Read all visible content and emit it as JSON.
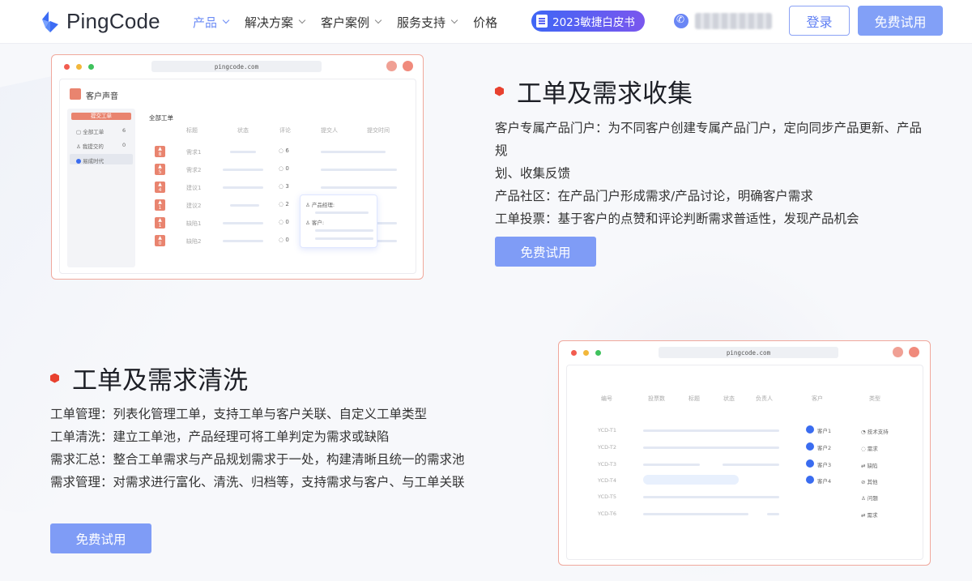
{
  "header": {
    "logo_text": "PingCode",
    "nav": [
      {
        "label": "产品",
        "has_dropdown": true,
        "active": true
      },
      {
        "label": "解决方案",
        "has_dropdown": true,
        "active": false
      },
      {
        "label": "客户案例",
        "has_dropdown": true,
        "active": false
      },
      {
        "label": "服务支持",
        "has_dropdown": true,
        "active": false
      },
      {
        "label": "价格",
        "has_dropdown": false,
        "active": false
      }
    ],
    "badge": "2023敏捷白皮书",
    "login": "登录",
    "trial": "免费试用",
    "accent": "#6b8bf5"
  },
  "section1": {
    "title": "工单及需求收集",
    "lines": [
      "客户专属产品门户：为不同客户创建专属产品门户，定向同步产品更新、产品规",
      "划、收集反馈",
      "产品社区：在产品门户形成需求/产品讨论，明确客户需求",
      "工单投票：基于客户的点赞和评论判断需求普适性，发现产品机会"
    ],
    "cta": "免费试用"
  },
  "section2": {
    "title": "工单及需求清洗",
    "lines": [
      "工单管理：列表化管理工单，支持工单与客户关联、自定义工单类型",
      "工单清洗：建立工单池，产品经理可将工单判定为需求或缺陷",
      "需求汇总：整合工单需求与产品规划需求于一处，构建清晰且统一的需求池",
      "需求管理：对需求进行富化、清洗、归档等，支持需求与客户、与工单关联"
    ],
    "cta": "免费试用"
  },
  "mock1": {
    "url": "pingcode.com",
    "app_title": "客户声音",
    "submit_btn": "提交工单",
    "side_items": [
      {
        "label": "全部工单",
        "count": "6"
      },
      {
        "label": "我提交的",
        "count": "0"
      },
      {
        "label": "易成时代",
        "count": ""
      }
    ],
    "section_label": "全部工单",
    "columns": [
      "标题",
      "状态",
      "评论",
      "提交人",
      "提交时间"
    ],
    "rows": [
      {
        "votes": "8",
        "title": "需求1",
        "comments": "6"
      },
      {
        "votes": "5",
        "title": "需求2",
        "comments": "0"
      },
      {
        "votes": "4",
        "title": "建议1",
        "comments": "3"
      },
      {
        "votes": "1",
        "title": "建议2",
        "comments": "2"
      },
      {
        "votes": "1",
        "title": "缺陷1",
        "comments": "0"
      },
      {
        "votes": "0",
        "title": "缺陷2",
        "comments": "0"
      }
    ],
    "popup": [
      "产品经理:",
      "客户:"
    ]
  },
  "mock2": {
    "url": "pingcode.com",
    "columns": [
      "编号",
      "投票数",
      "标题",
      "状态",
      "负责人",
      "客户",
      "类型"
    ],
    "rows": [
      {
        "id": "YCD-T1",
        "customer": "客户1",
        "type": "技术支持"
      },
      {
        "id": "YCD-T2",
        "customer": "客户2",
        "type": "需求"
      },
      {
        "id": "YCD-T3",
        "customer": "客户3",
        "type": "缺陷"
      },
      {
        "id": "YCD-T4",
        "customer": "客户4",
        "type": "其他"
      },
      {
        "id": "YCD-T5",
        "customer": "",
        "type": "问题"
      },
      {
        "id": "YCD-T6",
        "customer": "",
        "type": "需求"
      }
    ]
  }
}
